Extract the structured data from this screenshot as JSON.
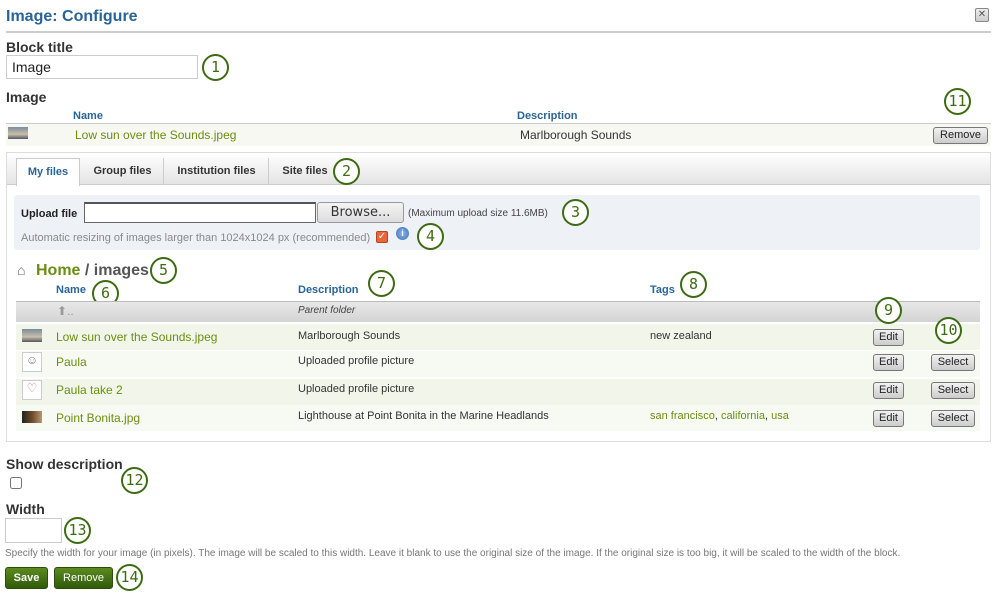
{
  "header": {
    "title": "Image: Configure",
    "close_icon": "close-icon"
  },
  "block_title": {
    "label": "Block title",
    "value": "Image"
  },
  "image_section": {
    "label": "Image",
    "columns": [
      "Name",
      "Description"
    ],
    "selected": {
      "name": "Low sun over the Sounds.jpeg",
      "description": "Marlborough Sounds"
    },
    "remove_label": "Remove"
  },
  "tabs": [
    {
      "label": "My files",
      "active": true
    },
    {
      "label": "Group files",
      "active": false
    },
    {
      "label": "Institution files",
      "active": false
    },
    {
      "label": "Site files",
      "active": false
    }
  ],
  "upload": {
    "label": "Upload file",
    "value": "",
    "browse_label": "Browse...",
    "max_size": "(Maximum upload size 11.6MB)",
    "resize_text": "Automatic resizing of images larger than 1024x1024 px (recommended)",
    "resize_checked": true
  },
  "breadcrumb": {
    "home": "Home",
    "separator": " / ",
    "folder": "images"
  },
  "files": {
    "columns": [
      "Name",
      "Description",
      "Tags"
    ],
    "parent": {
      "name": "..",
      "description": "Parent folder"
    },
    "rows": [
      {
        "name": "Low sun over the Sounds.jpeg",
        "description": "Marlborough Sounds",
        "tags": [
          "new zealand"
        ],
        "edit": "Edit",
        "select": ""
      },
      {
        "name": "Paula",
        "description": "Uploaded profile picture",
        "tags": [],
        "edit": "Edit",
        "select": "Select"
      },
      {
        "name": "Paula take 2",
        "description": "Uploaded profile picture",
        "tags": [],
        "edit": "Edit",
        "select": "Select"
      },
      {
        "name": "Point Bonita.jpg",
        "description": "Lighthouse at Point Bonita in the Marine Headlands",
        "tags": [
          "san francisco",
          "california",
          "usa"
        ],
        "edit": "Edit",
        "select": "Select"
      }
    ]
  },
  "show_description": {
    "label": "Show description",
    "checked": false
  },
  "width": {
    "label": "Width",
    "value": "",
    "help": "Specify the width for your image (in pixels). The image will be scaled to this width. Leave it blank to use the original size of the image. If the original size is too big, it will be scaled to the width of the block."
  },
  "actions": {
    "save": "Save",
    "remove": "Remove"
  },
  "callouts": [
    "1",
    "2",
    "3",
    "4",
    "5",
    "6",
    "7",
    "8",
    "9",
    "10",
    "11",
    "12",
    "13",
    "14"
  ],
  "colors": {
    "title": "#2a6496",
    "link": "#6b8e12",
    "callout": "#3d6b12",
    "primary_button": "#3f6e14"
  }
}
